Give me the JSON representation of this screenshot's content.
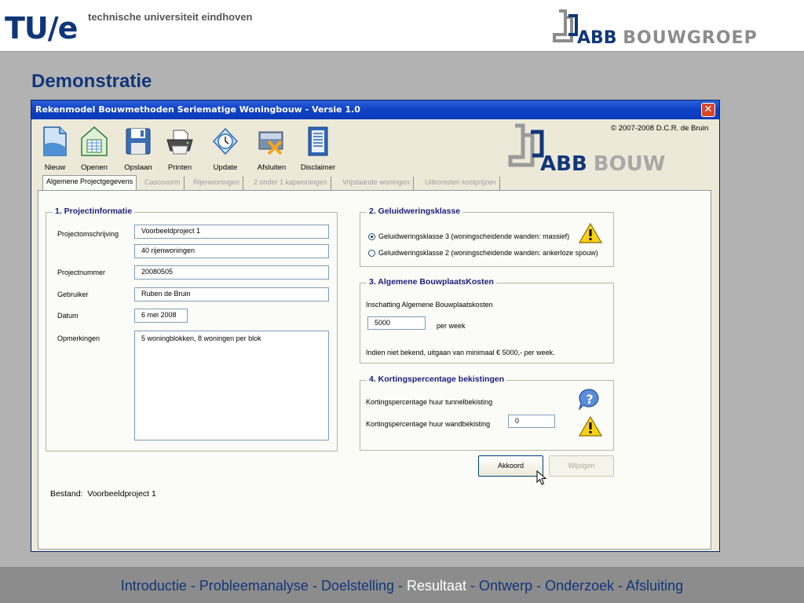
{
  "header": {
    "tue_logo": "TU/e",
    "tue_subtitle": "technische universiteit eindhoven",
    "abb_brand": "ABB",
    "abb_group": "BOUWGROEP"
  },
  "slide_title": "Demonstratie",
  "window": {
    "title": "Rekenmodel Bouwmethoden Seriematige Woningbouw  -  Versie 1.0",
    "copyright": "© 2007-2008 D.C.R. de Bruin",
    "abb_brand": "ABB",
    "abb_suffix": "BOUW"
  },
  "toolbar": [
    {
      "label": "Nieuw",
      "icon": "new-document-icon"
    },
    {
      "label": "Openen",
      "icon": "open-spreadsheet-icon"
    },
    {
      "label": "Opslaan",
      "icon": "floppy-disk-icon"
    },
    {
      "label": "Printen",
      "icon": "printer-icon"
    },
    {
      "label": "Update",
      "icon": "clock-update-icon"
    },
    {
      "label": "Afsluiten",
      "icon": "close-app-icon"
    },
    {
      "label": "Disclaimer",
      "icon": "disclaimer-document-icon"
    }
  ],
  "tabs": [
    {
      "label": "Algemene Projectgegevens",
      "active": true
    },
    {
      "label": "Cascovorm",
      "active": false
    },
    {
      "label": "Rijenwoningen",
      "active": false
    },
    {
      "label": "2 onder 1 kapwoningen",
      "active": false
    },
    {
      "label": "Vrijstaande woningen",
      "active": false
    },
    {
      "label": "Uitkomsten kostprijzen",
      "active": false
    }
  ],
  "project": {
    "title": "1. Projectinformatie",
    "omschrijving_label": "Projectomschrijving",
    "omschrijving_1": "Voorbeeldproject 1",
    "omschrijving_2": "40 rijenwoningen",
    "nummer_label": "Projectnummer",
    "nummer": "20080505",
    "gebruiker_label": "Gebruiker",
    "gebruiker": "Ruben de Bruin",
    "datum_label": "Datum",
    "datum": "6 mei 2008",
    "opmerkingen_label": "Opmerkingen",
    "opmerkingen": "5 woningblokken, 8 woningen per blok"
  },
  "geluid": {
    "title": "2. Geluidweringsklasse",
    "option_3": "Geluidweringsklasse 3 (woningscheidende wanden: massief)",
    "option_2": "Geluidweringsklasse 2 (woningscheidende wanden: ankerloze spouw)",
    "selected": "option_3"
  },
  "kosten": {
    "title": "3. Algemene BouwplaatsKosten",
    "label": "Inschatting Algemene Bouwplaatskosten",
    "value": "5000",
    "unit": "per week",
    "note": "Indien niet bekend, uitgaan van minimaal  € 5000,-  per week."
  },
  "korting": {
    "title": "4. Kortingspercentage bekistingen",
    "tunnel_label": "Kortingspercentage huur tunnelbekisting",
    "wand_label": "Kortingspercentage huur wandbekisting",
    "wand_value": "0"
  },
  "buttons": {
    "akkoord": "Akkoord",
    "wijzigen": "Wijzigen"
  },
  "bestand": {
    "label": "Bestand:",
    "value": "Voorbeeldproject 1"
  },
  "nav": {
    "items": [
      "Introductie",
      "Probleemanalyse",
      "Doelstelling",
      "Resultaat",
      "Ontwerp",
      "Onderzoek",
      "Afsluiting"
    ],
    "current": "Resultaat",
    "separator": " - "
  },
  "colors": {
    "brand_blue": "#10367a",
    "titlebar_blue": "#0a3bb8",
    "nav_current": "#ffffff"
  }
}
